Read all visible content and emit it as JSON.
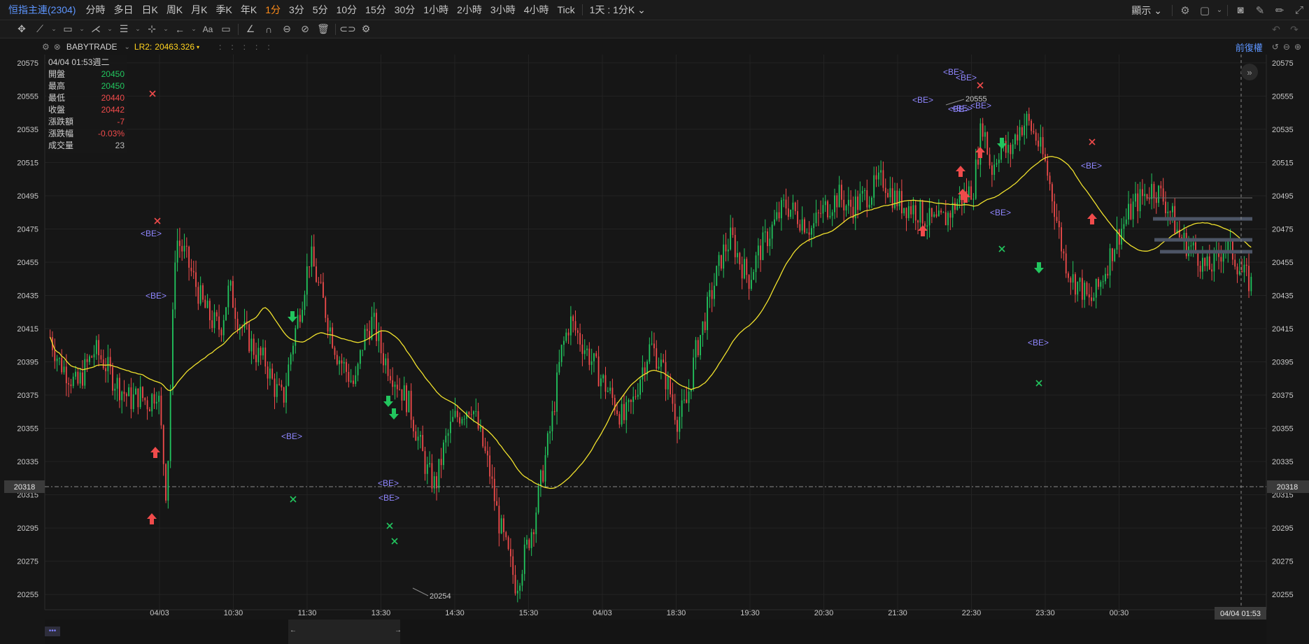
{
  "header": {
    "symbol": "恒指主連(2304)",
    "timeframes": [
      "分時",
      "多日",
      "日K",
      "周K",
      "月K",
      "季K",
      "年K",
      "1分",
      "3分",
      "5分",
      "10分",
      "15分",
      "30分",
      "1小時",
      "2小時",
      "3小時",
      "4小時",
      "Tick"
    ],
    "active_timeframe": "1分",
    "range_select": "1天 : 1分K",
    "display_menu": "顯示"
  },
  "chart_header": {
    "indicator": "BABYTRADE",
    "lr_label": "LR2:",
    "lr_value": "20463.326",
    "adjust": "前復權"
  },
  "info_box": {
    "datetime": "04/04 01:53週二",
    "rows": [
      {
        "k": "開盤",
        "v": "20450",
        "c": "up"
      },
      {
        "k": "最高",
        "v": "20450",
        "c": "up"
      },
      {
        "k": "最低",
        "v": "20440",
        "c": "dn"
      },
      {
        "k": "收盤",
        "v": "20442",
        "c": "dn"
      },
      {
        "k": "漲跌額",
        "v": "-7",
        "c": "dn"
      },
      {
        "k": "漲跌幅",
        "v": "-0.03%",
        "c": "dn"
      },
      {
        "k": "成交量",
        "v": "23",
        "c": "nt"
      }
    ]
  },
  "chart_data": {
    "type": "candlestick",
    "y_axis_ticks": [
      20575,
      20555,
      20535,
      20515,
      20495,
      20475,
      20455,
      20435,
      20415,
      20395,
      20375,
      20355,
      20335,
      20315,
      20295,
      20275,
      20255
    ],
    "ylim": [
      20250,
      20580
    ],
    "x_axis_ticks": [
      "04/03",
      "10:30",
      "11:30",
      "13:30",
      "14:30",
      "15:30",
      "04/03",
      "18:30",
      "19:30",
      "20:30",
      "21:30",
      "22:30",
      "23:30",
      "00:30"
    ],
    "crosshair_price": "20318",
    "crosshair_time": "04/04 01:53",
    "high_label": "20555",
    "low_label": "20254",
    "ma_line_color": "#f0e12d",
    "up_color": "#22c55e",
    "down_color": "#f04b4b",
    "signal_label": "<BE>",
    "close_path": [
      20410,
      20395,
      20388,
      20380,
      20392,
      20402,
      20395,
      20385,
      20378,
      20372,
      20375,
      20370,
      20380,
      20312,
      20470,
      20460,
      20445,
      20430,
      20420,
      20415,
      20440,
      20420,
      20410,
      20400,
      20395,
      20380,
      20372,
      20405,
      20430,
      20460,
      20440,
      20420,
      20400,
      20390,
      20380,
      20410,
      20420,
      20400,
      20390,
      20380,
      20370,
      20350,
      20330,
      20320,
      20345,
      20360,
      20365,
      20370,
      20350,
      20330,
      20300,
      20280,
      20260,
      20280,
      20300,
      20330,
      20360,
      20400,
      20420,
      20410,
      20400,
      20390,
      20380,
      20370,
      20360,
      20370,
      20390,
      20405,
      20395,
      20380,
      20360,
      20370,
      20400,
      20420,
      20440,
      20460,
      20470,
      20455,
      20445,
      20460,
      20470,
      20480,
      20490,
      20485,
      20480,
      20475,
      20485,
      20490,
      20495,
      20488,
      20490,
      20495,
      20500,
      20505,
      20495,
      20490,
      20488,
      20485,
      20480,
      20478,
      20482,
      20490,
      20495,
      20500,
      20540,
      20510,
      20525,
      20520,
      20535,
      20540,
      20530,
      20515,
      20490,
      20460,
      20445,
      20440,
      20430,
      20440,
      20455,
      20470,
      20480,
      20490,
      20495,
      20500,
      20495,
      20485,
      20470,
      20465,
      20460,
      20450,
      20455,
      20465,
      20460,
      20448,
      20442
    ]
  },
  "navigator": {
    "handle": "•••",
    "left_arrow": "←",
    "right_arrow": "→"
  }
}
